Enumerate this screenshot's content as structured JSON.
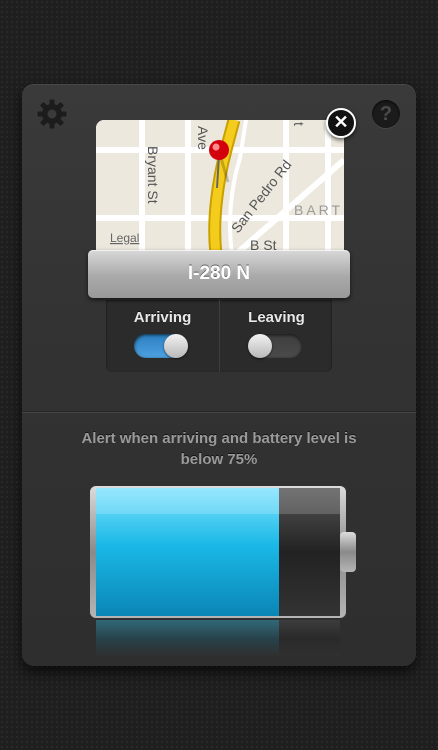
{
  "map": {
    "labels": {
      "ave": "Ave",
      "bryant": "Bryant St",
      "san_pedro": "San Pedro Rd",
      "bart": "BART",
      "bst": "B St",
      "t": "t",
      "legal": "Legal"
    }
  },
  "location": {
    "name": "I-280 N"
  },
  "toggles": {
    "arriving": {
      "label": "Arriving",
      "state": "on"
    },
    "leaving": {
      "label": "Leaving",
      "state": "off"
    }
  },
  "alert": {
    "text": "Alert when arriving and battery level is below 75%"
  },
  "battery": {
    "level_percent": 75
  },
  "buttons": {
    "close_glyph": "✕",
    "help_glyph": "?"
  },
  "icons": {
    "settings": "gear-icon",
    "help": "help-icon",
    "close": "close-icon",
    "pin": "map-pin-icon"
  },
  "colors": {
    "toggle_on": "#3a8fd0",
    "battery_fill": "#1ab8e6"
  }
}
